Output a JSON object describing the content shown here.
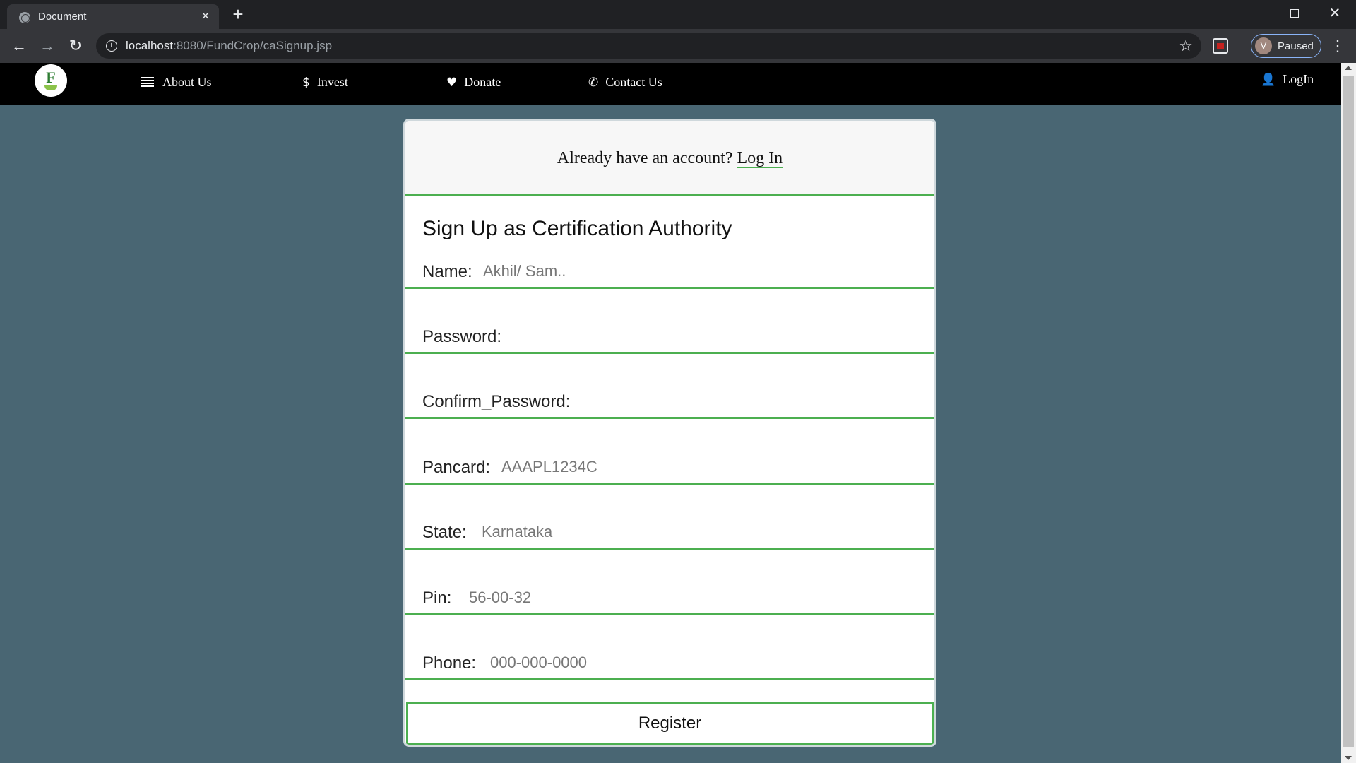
{
  "browser": {
    "tab_title": "Document",
    "url_host": "localhost",
    "url_path": ":8080/FundCrop/caSignup.jsp",
    "profile_initial": "V",
    "profile_status": "Paused"
  },
  "navbar": {
    "logo_letter": "F",
    "links": [
      {
        "label": "About Us",
        "icon": "bars-icon"
      },
      {
        "label": "Invest",
        "icon": "dollar-icon"
      },
      {
        "label": "Donate",
        "icon": "heart-icon"
      },
      {
        "label": "Contact Us",
        "icon": "phone-icon"
      }
    ],
    "login_label": "LogIn"
  },
  "card": {
    "already_text": "Already have an account?",
    "login_link": "Log In",
    "title": "Sign Up as Certification Authority",
    "fields": [
      {
        "label": "Name:",
        "placeholder": "Akhil/ Sam..",
        "value": ""
      },
      {
        "label": "Password:",
        "placeholder": "",
        "value": ""
      },
      {
        "label": "Confirm_Password:",
        "placeholder": "",
        "value": ""
      },
      {
        "label": "Pancard:",
        "placeholder": "AAAPL1234C",
        "value": ""
      },
      {
        "label": "State:",
        "placeholder": "Karnataka",
        "value": ""
      },
      {
        "label": "Pin:",
        "placeholder": "56-00-32",
        "value": ""
      },
      {
        "label": "Phone:",
        "placeholder": "000-000-0000",
        "value": ""
      }
    ],
    "register_label": "Register"
  },
  "colors": {
    "page_background": "#496673",
    "accent_green": "#4caf50",
    "navbar_background": "#000000"
  }
}
